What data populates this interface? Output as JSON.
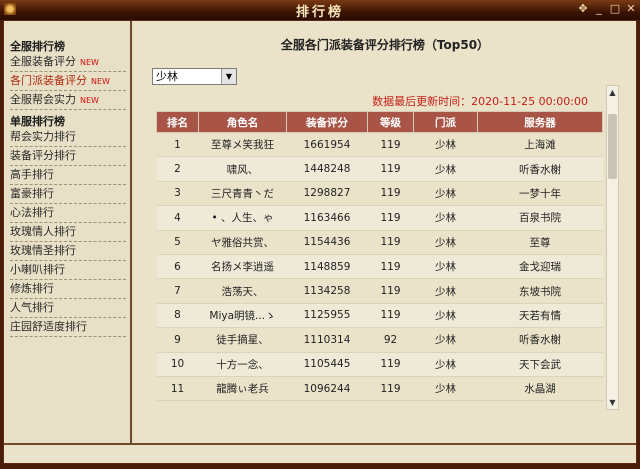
{
  "window": {
    "title": "排行榜"
  },
  "sidebar": {
    "section_all": "全服排行榜",
    "items_all": [
      {
        "label": "全服装备评分",
        "badge": "NEW"
      },
      {
        "label": "各门派装备评分",
        "badge": "NEW"
      },
      {
        "label": "全服帮会实力",
        "badge": "NEW"
      }
    ],
    "section_single": "单服排行榜",
    "items_single": [
      "帮会实力排行",
      "装备评分排行",
      "高手排行",
      "富豪排行",
      "心法排行",
      "玫瑰情人排行",
      "玫瑰情圣排行",
      "小喇叭排行",
      "修炼排行",
      "人气排行",
      "庄园舒适度排行"
    ]
  },
  "main": {
    "title": "全服各门派装备评分排行榜（Top50）",
    "faction_select": "少林",
    "update_time": "数据最后更新时间：2020-11-25 00:00:00",
    "columns": [
      "排名",
      "角色名",
      "装备评分",
      "等级",
      "门派",
      "服务器"
    ],
    "rows": [
      [
        "1",
        "至尊メ笑我狂",
        "1661954",
        "119",
        "少林",
        "上海滩"
      ],
      [
        "2",
        "啸风、",
        "1448248",
        "119",
        "少林",
        "听香水榭"
      ],
      [
        "3",
        "三尺青青丶だ",
        "1298827",
        "119",
        "少林",
        "一梦十年"
      ],
      [
        "4",
        "• 、人生、ゃ",
        "1163466",
        "119",
        "少林",
        "百泉书院"
      ],
      [
        "5",
        "ヤ雅俗共赏、",
        "1154436",
        "119",
        "少林",
        "至尊"
      ],
      [
        "6",
        "名扬メ李逍遥",
        "1148859",
        "119",
        "少林",
        "金戈迎瑞"
      ],
      [
        "7",
        "浩荡天、",
        "1134258",
        "119",
        "少林",
        "东坡书院"
      ],
      [
        "8",
        "Miya明镜...ゝ",
        "1125955",
        "119",
        "少林",
        "天若有情"
      ],
      [
        "9",
        "徒手摘星、",
        "1110314",
        "92",
        "少林",
        "听香水榭"
      ],
      [
        "10",
        "十方一念、",
        "1105445",
        "119",
        "少林",
        "天下会武"
      ],
      [
        "11",
        "龍腾ぃ老兵",
        "1096244",
        "119",
        "少林",
        "水晶湖"
      ]
    ]
  }
}
